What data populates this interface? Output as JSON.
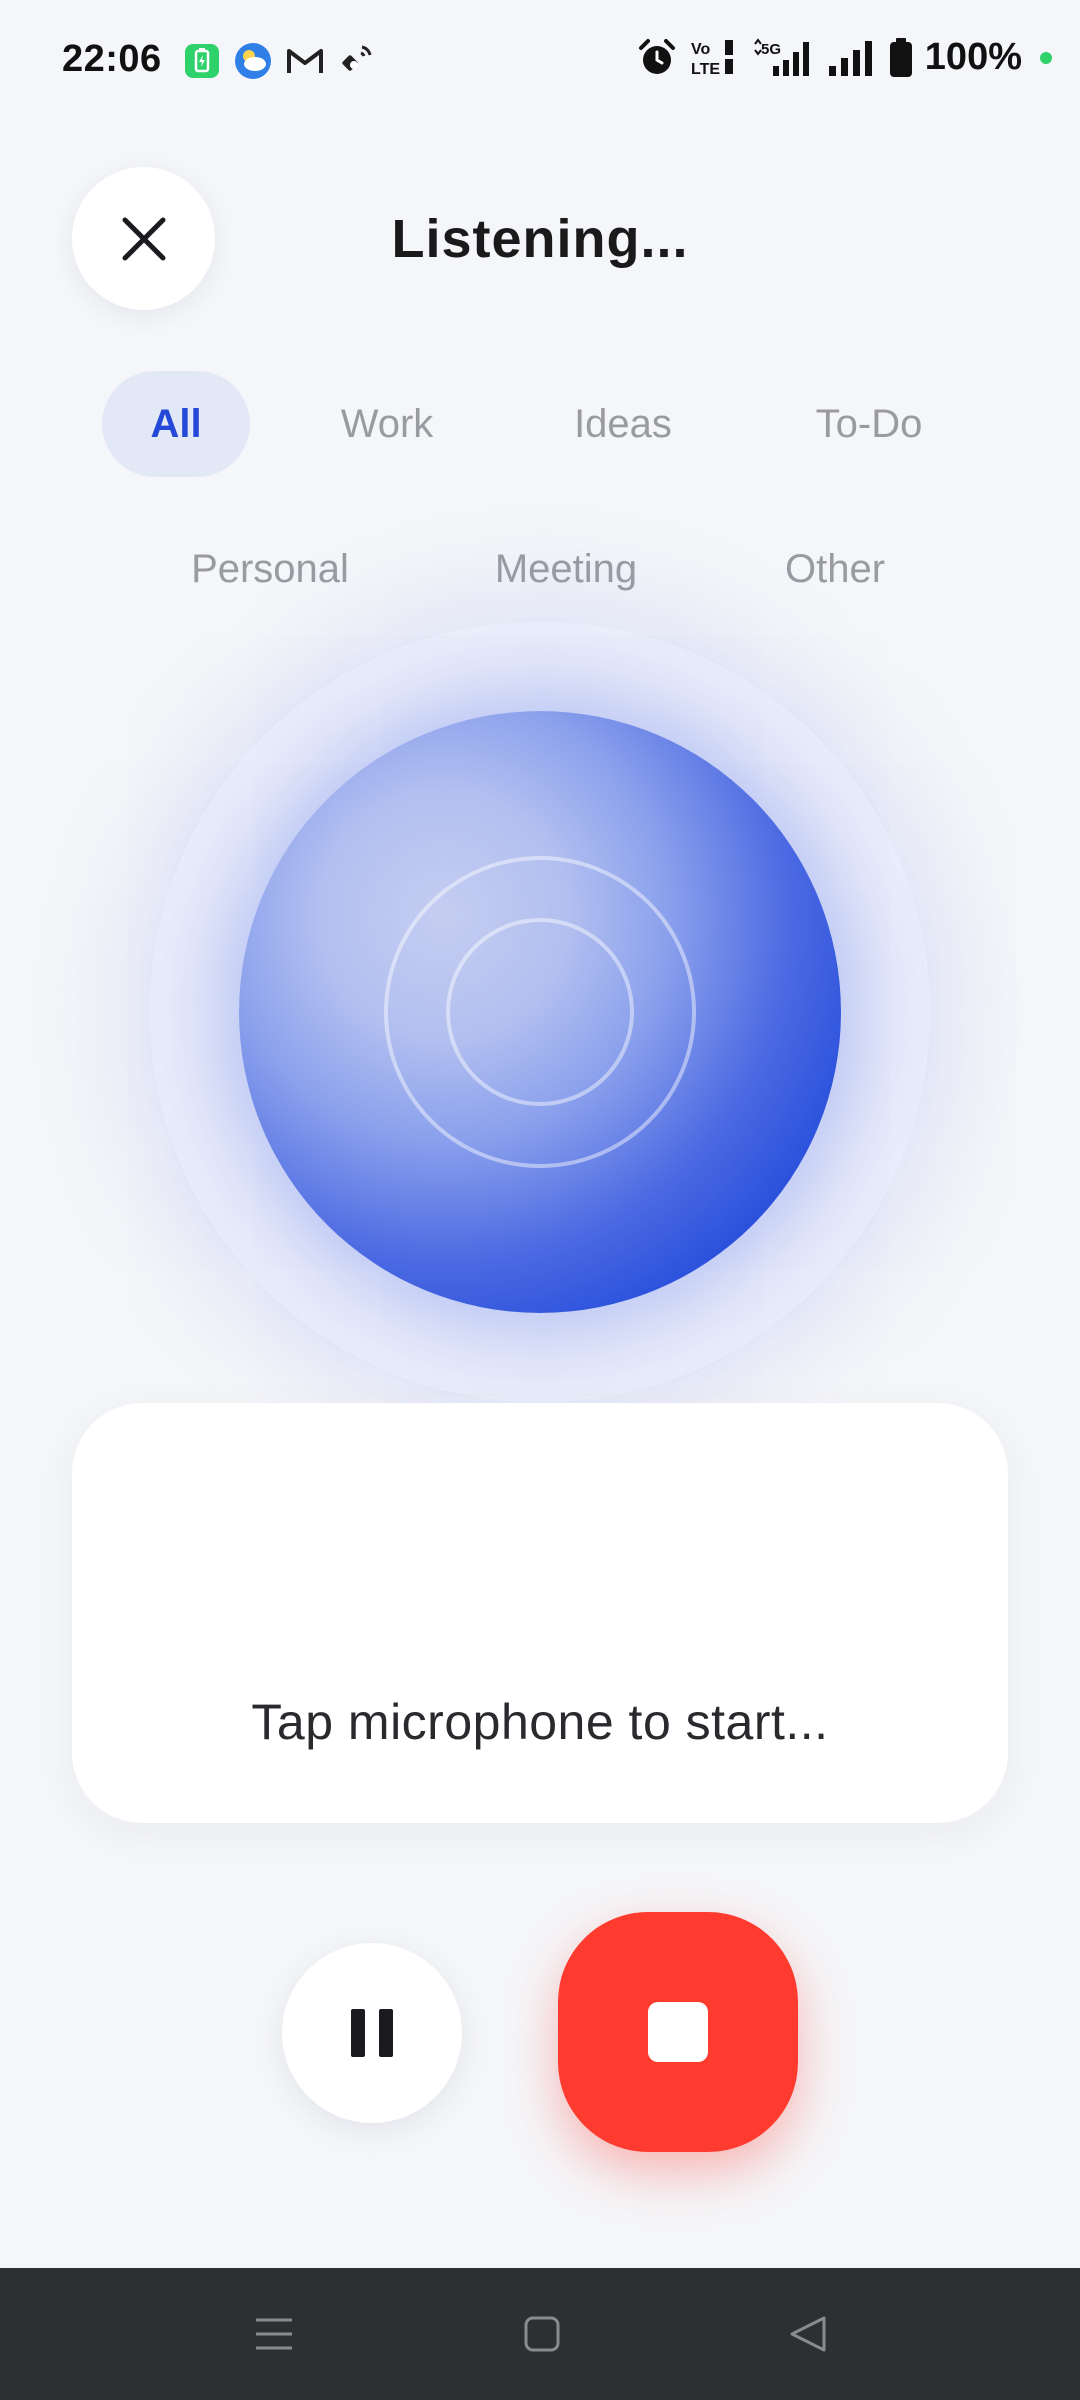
{
  "status_bar": {
    "time": "22:06",
    "battery_text": "100%",
    "network_labels": [
      "Vo",
      "LTE",
      "5G"
    ],
    "left_icons": [
      "battery-saver-icon",
      "weather-icon",
      "gmail-icon",
      "satellite-icon"
    ],
    "right_icons": [
      "alarm-icon",
      "volte-icon",
      "signal-5g-icon",
      "signal-icon",
      "battery-icon"
    ],
    "dot_color": "#2fd16b"
  },
  "header": {
    "title": "Listening...",
    "close_icon": "close-icon"
  },
  "categories": {
    "row1": [
      "All",
      "Work",
      "Ideas",
      "To-Do"
    ],
    "row2": [
      "Personal",
      "Meeting",
      "Other"
    ],
    "selected": "All",
    "active_bg": "#e3e8f6",
    "active_color": "#2449d8"
  },
  "orb": {
    "accent": "#2650dd"
  },
  "transcript": {
    "placeholder": "Tap microphone to start..."
  },
  "controls": {
    "pause_icon": "pause-icon",
    "stop_icon": "stop-icon",
    "stop_color": "#ff3b30"
  },
  "nav": {
    "icons": [
      "menu-icon",
      "home-icon",
      "back-icon"
    ]
  }
}
